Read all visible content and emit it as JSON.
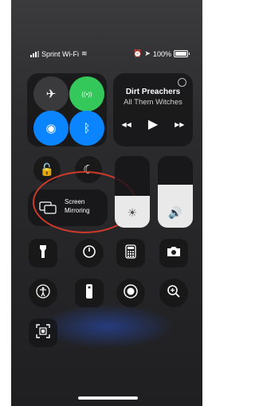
{
  "status_bar": {
    "carrier": "Sprint Wi-Fi",
    "battery": "100%",
    "icons": [
      "signal-icon",
      "wifi-icon",
      "alarm-icon",
      "location-icon",
      "battery-icon"
    ]
  },
  "connectivity": {
    "airplane": {
      "icon": "airplane-icon",
      "glyph": "✈",
      "active": false
    },
    "cellular": {
      "icon": "cellular-data-icon",
      "glyph": "((•))",
      "active": true,
      "color": "#34c759"
    },
    "wifi": {
      "icon": "wifi-icon",
      "glyph": "◉",
      "active": true,
      "color": "#0a84ff"
    },
    "bluetooth": {
      "icon": "bluetooth-icon",
      "glyph": "ᛒ",
      "active": true,
      "color": "#0a84ff"
    }
  },
  "media": {
    "title": "Dirt Preachers",
    "artist": "All Them Witches",
    "prev": "◀◀",
    "play": "▶",
    "next": "▶▶"
  },
  "toggles": {
    "rotation_lock": "rotation-lock-icon",
    "do_not_disturb": "moon-icon"
  },
  "screen_mirroring": {
    "line1": "Screen",
    "line2": "Mirroring",
    "icon": "screen-mirroring-icon",
    "annotation_color": "#cc3a2a"
  },
  "brightness": {
    "level": 0.45,
    "glyph": "☀",
    "icon": "sun-icon"
  },
  "volume": {
    "level": 0.6,
    "glyph": "🔊",
    "icon": "speaker-icon"
  },
  "row3": [
    {
      "icon": "flashlight-icon",
      "glyph": "🔦"
    },
    {
      "icon": "timer-icon",
      "glyph": "◔"
    },
    {
      "icon": "calculator-icon",
      "glyph": "▦"
    },
    {
      "icon": "camera-icon",
      "glyph": "📷"
    }
  ],
  "row4": [
    {
      "icon": "accessibility-icon",
      "glyph": "♿"
    },
    {
      "icon": "apple-tv-remote-icon",
      "glyph": "▮"
    },
    {
      "icon": "screen-recording-icon",
      "glyph": "◉"
    },
    {
      "icon": "magnifier-icon",
      "glyph": "⊕"
    }
  ],
  "row5": [
    {
      "icon": "qr-code-scanner-icon",
      "glyph": "▣"
    }
  ]
}
